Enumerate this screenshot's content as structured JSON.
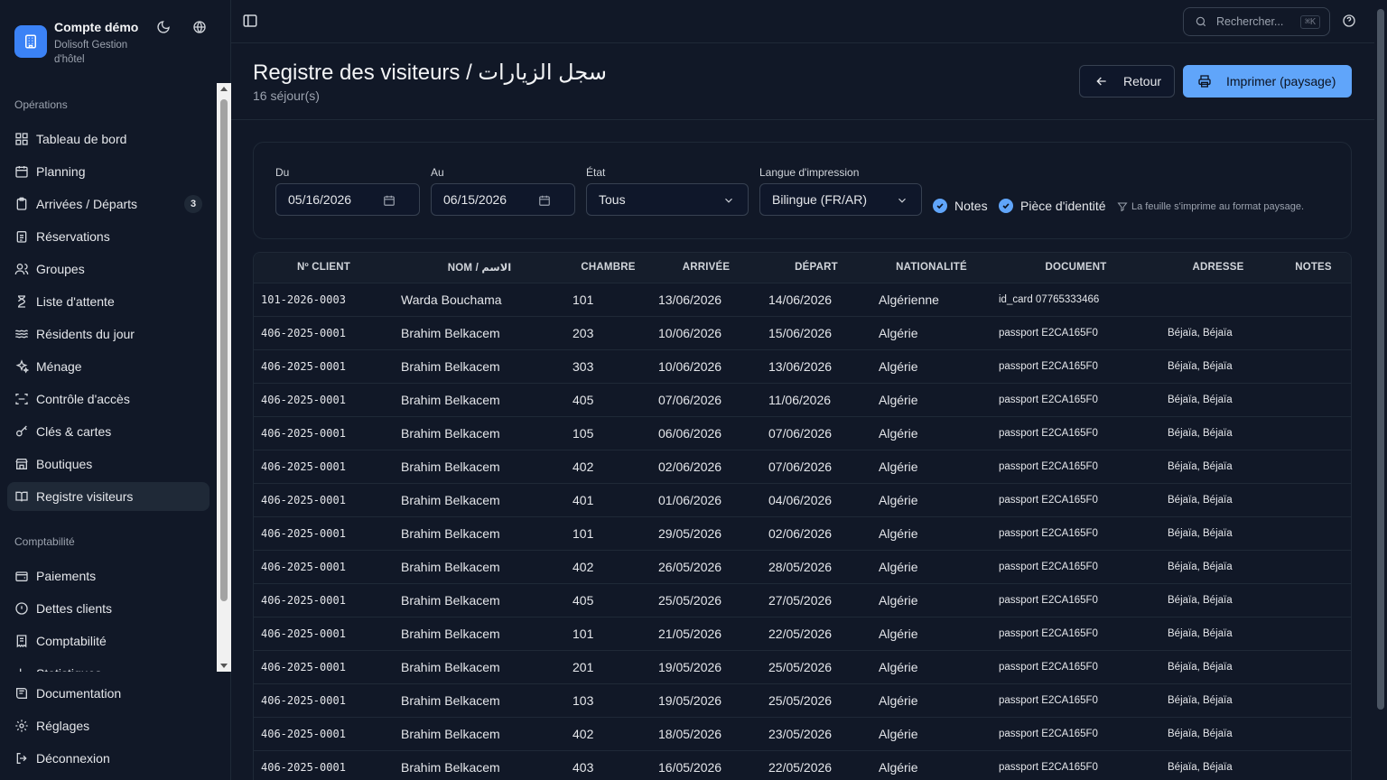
{
  "brand": {
    "title": "Compte démo",
    "subtitle": "Dolisoft Gestion d'hôtel"
  },
  "sidebar": {
    "section_operations": "Opérations",
    "items": [
      {
        "label": "Tableau de bord",
        "icon": "dashboard-icon"
      },
      {
        "label": "Planning",
        "icon": "calendar-icon"
      },
      {
        "label": "Arrivées / Départs",
        "icon": "clipboard-icon",
        "badge": "3"
      },
      {
        "label": "Réservations",
        "icon": "clipboard-list-icon"
      },
      {
        "label": "Groupes",
        "icon": "users-icon"
      },
      {
        "label": "Liste d'attente",
        "icon": "hourglass-icon"
      },
      {
        "label": "Résidents du jour",
        "icon": "waves-icon"
      },
      {
        "label": "Ménage",
        "icon": "sparkles-icon"
      },
      {
        "label": "Contrôle d'accès",
        "icon": "scan-icon"
      },
      {
        "label": "Clés & cartes",
        "icon": "key-icon"
      },
      {
        "label": "Boutiques",
        "icon": "store-icon"
      },
      {
        "label": "Registre visiteurs",
        "icon": "book-icon",
        "active": true
      }
    ],
    "section_accounting": "Comptabilité",
    "accounting_items": [
      {
        "label": "Paiements",
        "icon": "wallet-icon"
      },
      {
        "label": "Dettes clients",
        "icon": "alert-circle-icon"
      },
      {
        "label": "Comptabilité",
        "icon": "receipt-icon"
      },
      {
        "label": "Statistiques",
        "icon": "bar-chart-icon"
      }
    ],
    "bottom_items": [
      {
        "label": "Documentation",
        "icon": "book-open-icon"
      },
      {
        "label": "Réglages",
        "icon": "gear-icon"
      },
      {
        "label": "Déconnexion",
        "icon": "logout-icon"
      }
    ]
  },
  "topbar": {
    "search_placeholder": "Rechercher...",
    "search_shortcut": "⌘K"
  },
  "header": {
    "title": "Registre des visiteurs / سجل الزيارات",
    "subtitle": "16 séjour(s)",
    "back_label": "Retour",
    "print_label": "Imprimer (paysage)"
  },
  "filters": {
    "from_label": "Du",
    "from_value": "05/16/2026",
    "to_label": "Au",
    "to_value": "06/15/2026",
    "state_label": "État",
    "state_value": "Tous",
    "lang_label": "Langue d'impression",
    "lang_value": "Bilingue (FR/AR)",
    "notes_label": "Notes",
    "id_label": "Pièce d'identité",
    "hint": "La feuille s'imprime au format paysage."
  },
  "table": {
    "headers": [
      "Nº CLIENT",
      "NOM / الاسم",
      "CHAMBRE",
      "ARRIVÉE",
      "DÉPART",
      "NATIONALITÉ",
      "DOCUMENT",
      "ADRESSE",
      "NOTES"
    ],
    "rows": [
      [
        "101-2026-0003",
        "Warda Bouchama",
        "101",
        "13/06/2026",
        "14/06/2026",
        "Algérienne",
        "id_card 07765333466",
        "",
        ""
      ],
      [
        "406-2025-0001",
        "Brahim Belkacem",
        "203",
        "10/06/2026",
        "15/06/2026",
        "Algérie",
        "passport E2CA165F0",
        "Béjaïa, Béjaïa",
        ""
      ],
      [
        "406-2025-0001",
        "Brahim Belkacem",
        "303",
        "10/06/2026",
        "13/06/2026",
        "Algérie",
        "passport E2CA165F0",
        "Béjaïa, Béjaïa",
        ""
      ],
      [
        "406-2025-0001",
        "Brahim Belkacem",
        "405",
        "07/06/2026",
        "11/06/2026",
        "Algérie",
        "passport E2CA165F0",
        "Béjaïa, Béjaïa",
        ""
      ],
      [
        "406-2025-0001",
        "Brahim Belkacem",
        "105",
        "06/06/2026",
        "07/06/2026",
        "Algérie",
        "passport E2CA165F0",
        "Béjaïa, Béjaïa",
        ""
      ],
      [
        "406-2025-0001",
        "Brahim Belkacem",
        "402",
        "02/06/2026",
        "07/06/2026",
        "Algérie",
        "passport E2CA165F0",
        "Béjaïa, Béjaïa",
        ""
      ],
      [
        "406-2025-0001",
        "Brahim Belkacem",
        "401",
        "01/06/2026",
        "04/06/2026",
        "Algérie",
        "passport E2CA165F0",
        "Béjaïa, Béjaïa",
        ""
      ],
      [
        "406-2025-0001",
        "Brahim Belkacem",
        "101",
        "29/05/2026",
        "02/06/2026",
        "Algérie",
        "passport E2CA165F0",
        "Béjaïa, Béjaïa",
        ""
      ],
      [
        "406-2025-0001",
        "Brahim Belkacem",
        "402",
        "26/05/2026",
        "28/05/2026",
        "Algérie",
        "passport E2CA165F0",
        "Béjaïa, Béjaïa",
        ""
      ],
      [
        "406-2025-0001",
        "Brahim Belkacem",
        "405",
        "25/05/2026",
        "27/05/2026",
        "Algérie",
        "passport E2CA165F0",
        "Béjaïa, Béjaïa",
        ""
      ],
      [
        "406-2025-0001",
        "Brahim Belkacem",
        "101",
        "21/05/2026",
        "22/05/2026",
        "Algérie",
        "passport E2CA165F0",
        "Béjaïa, Béjaïa",
        ""
      ],
      [
        "406-2025-0001",
        "Brahim Belkacem",
        "201",
        "19/05/2026",
        "25/05/2026",
        "Algérie",
        "passport E2CA165F0",
        "Béjaïa, Béjaïa",
        ""
      ],
      [
        "406-2025-0001",
        "Brahim Belkacem",
        "103",
        "19/05/2026",
        "25/05/2026",
        "Algérie",
        "passport E2CA165F0",
        "Béjaïa, Béjaïa",
        ""
      ],
      [
        "406-2025-0001",
        "Brahim Belkacem",
        "402",
        "18/05/2026",
        "23/05/2026",
        "Algérie",
        "passport E2CA165F0",
        "Béjaïa, Béjaïa",
        ""
      ],
      [
        "406-2025-0001",
        "Brahim Belkacem",
        "403",
        "16/05/2026",
        "22/05/2026",
        "Algérie",
        "passport E2CA165F0",
        "Béjaïa, Béjaïa",
        ""
      ]
    ]
  }
}
